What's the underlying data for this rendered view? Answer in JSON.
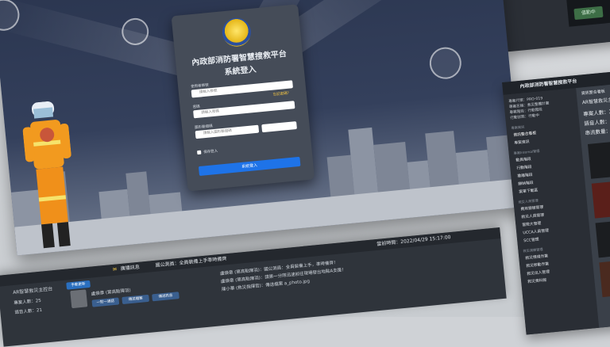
{
  "login": {
    "title": "內政部消防署智慧搜救平台",
    "subtitle": "系統登入",
    "account_label": "使用者帳號",
    "account_placeholder": "請輸入帳號",
    "forgot": "忘記密碼？",
    "password_label": "密碼",
    "password_placeholder": "請輸入密碼",
    "captcha_label": "圖形驗證碼",
    "captcha_placeholder": "請輸入圖形驗證碼",
    "remember": "保存登入",
    "submit": "系統登入"
  },
  "top_right": {
    "busy": "值勤中"
  },
  "side_dashboard": {
    "title": "內政部消防署智慧搜救平台",
    "info": [
      "專案代號：PRO-019",
      "專案名稱：救災整體計畫",
      "專案階段：行動階段",
      "行動狀態：行動中"
    ],
    "main_title": "資訊整合看板",
    "panel_title": "AR智慧救災主控台",
    "stats": [
      "專案人數：25",
      "語音人數：21",
      "串流數量：1"
    ],
    "nav_section1": "專案資訊",
    "nav_items1": [
      "資訊整合看板",
      "專案資訊"
    ],
    "nav_section2": "專案Internal管理",
    "nav_items2": [
      "動員階段",
      "行動階段",
      "撤離階段",
      "歸納階段",
      "案單下載區"
    ],
    "nav_section3": "救災人員管理",
    "nav_items3": [
      "費用預報管理",
      "救災人員管理",
      "冒險大管理",
      "UCCA人員管理",
      "SCC管理"
    ],
    "nav_section4": "救災演練管理",
    "nav_items4": [
      "救災情境作業",
      "救災移動作業",
      "救災出入管理",
      "救災資料館"
    ]
  },
  "bottom_dashboard": {
    "panel_title": "AR智慧救災主控台",
    "manual_refresh": "手動更新",
    "stats": [
      "專案人數：25",
      "語音人數：21"
    ],
    "user_name": "盧煥章 (第高點陳羽)",
    "call_btn": "一對一通話",
    "location_btn": "傳送檔案",
    "msg_btn": "傳送訊息",
    "broadcast_label": "廣播訊息",
    "broadcast_text": "國公測員：全員裝備上手準時備齊",
    "time_label": "當前時間：2022/04/29 15:17:00",
    "messages": [
      "盧煥章 (第高點陳羽)：國公測員：全員裝備上手，準時備齊！",
      "盧煥章 (第高點陳羽)：請第一分隊迅速前往現場發出地點A支援！",
      "陳小華 (救災指揮官)：傳送檔案 a_photo.jpg"
    ]
  }
}
